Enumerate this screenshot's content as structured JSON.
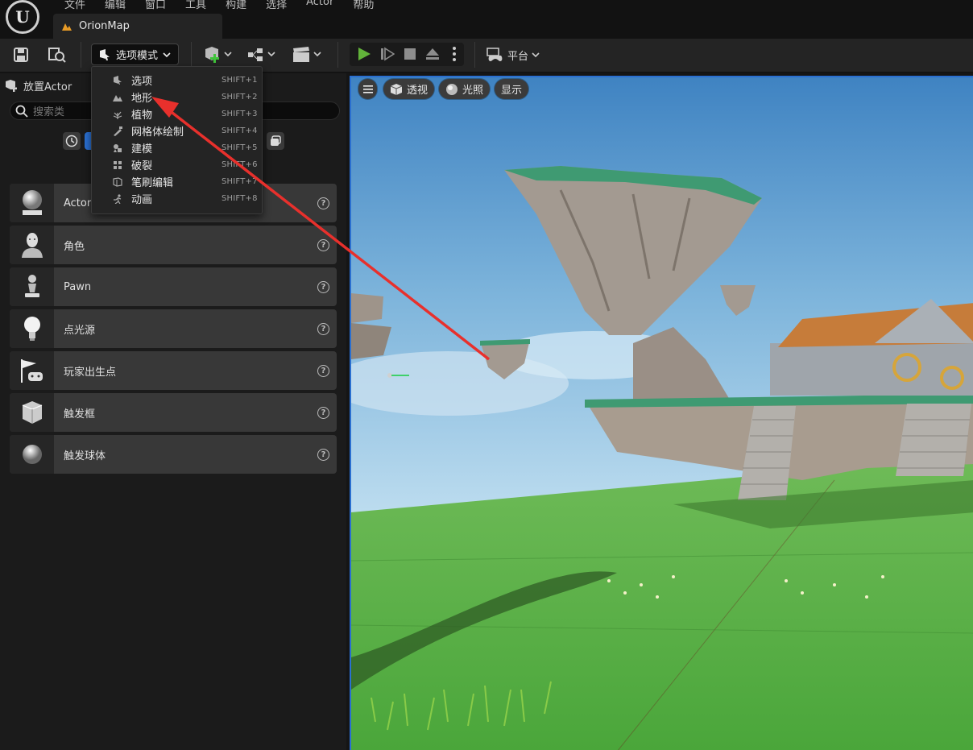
{
  "menu": [
    "文件",
    "编辑",
    "窗口",
    "工具",
    "构建",
    "选择",
    "Actor",
    "帮助"
  ],
  "tab": {
    "title": "OrionMap"
  },
  "toolbar": {
    "mode_label": "选项模式",
    "platform_label": "平台"
  },
  "place_panel": {
    "title": "放置Actor",
    "search_placeholder": "搜索类",
    "items": [
      {
        "label": "Actor"
      },
      {
        "label": "角色"
      },
      {
        "label": "Pawn"
      },
      {
        "label": "点光源"
      },
      {
        "label": "玩家出生点"
      },
      {
        "label": "触发框"
      },
      {
        "label": "触发球体"
      }
    ]
  },
  "viewport": {
    "perspective": "透视",
    "lighting": "光照",
    "show": "显示"
  },
  "mode_menu": [
    {
      "label": "选项",
      "shortcut": "SHIFT+1",
      "icon": "select-icon"
    },
    {
      "label": "地形",
      "shortcut": "SHIFT+2",
      "icon": "landscape-icon"
    },
    {
      "label": "植物",
      "shortcut": "SHIFT+3",
      "icon": "foliage-icon"
    },
    {
      "label": "网格体绘制",
      "shortcut": "SHIFT+4",
      "icon": "mesh-paint-icon"
    },
    {
      "label": "建模",
      "shortcut": "SHIFT+5",
      "icon": "modeling-icon"
    },
    {
      "label": "破裂",
      "shortcut": "SHIFT+6",
      "icon": "fracture-icon"
    },
    {
      "label": "笔刷编辑",
      "shortcut": "SHIFT+7",
      "icon": "brush-edit-icon"
    },
    {
      "label": "动画",
      "shortcut": "SHIFT+8",
      "icon": "animation-icon"
    }
  ],
  "colors": {
    "accent": "#2a6fd0",
    "play": "#62b33a",
    "arrow": "#e8302c",
    "grass": "#5aae43"
  }
}
